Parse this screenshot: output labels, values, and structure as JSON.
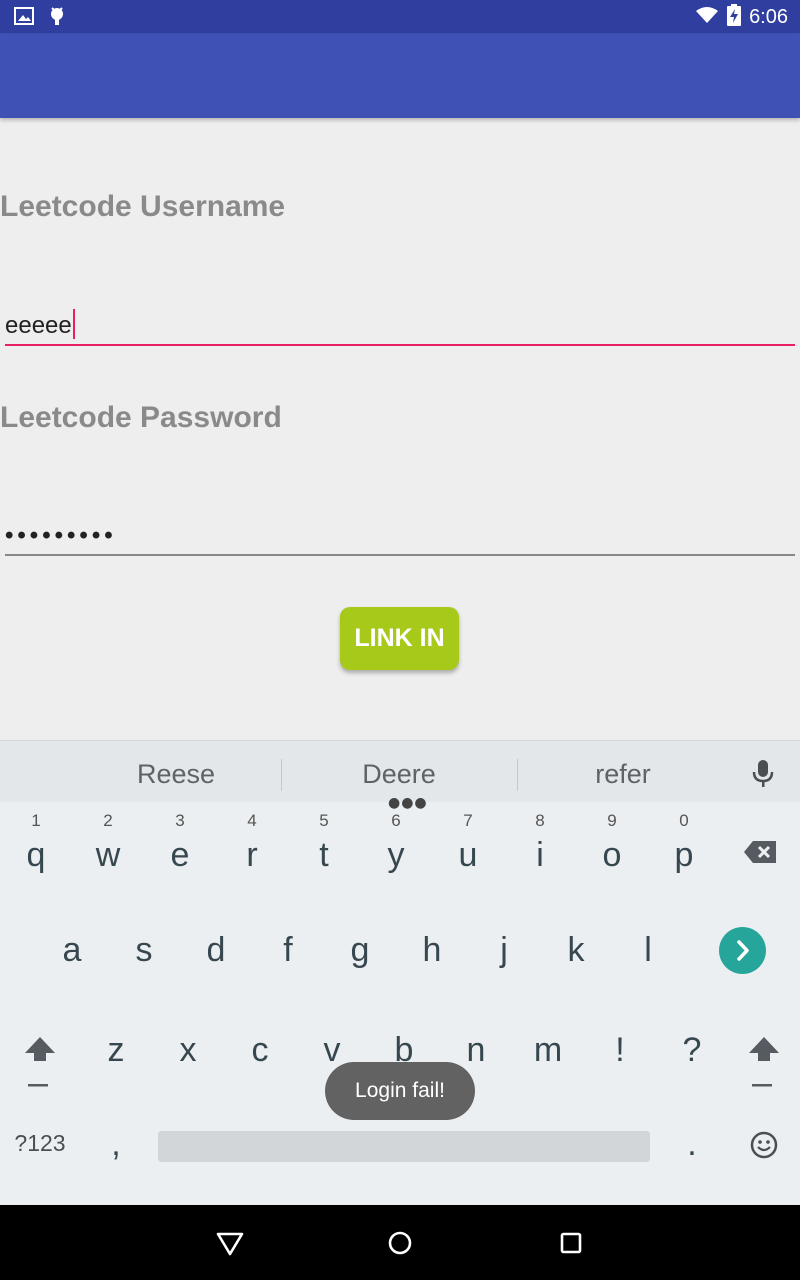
{
  "status_bar": {
    "time": "6:06",
    "left_icons": [
      "image-icon",
      "android-debug-icon"
    ],
    "right_icons": [
      "wifi-icon",
      "battery-charging-icon"
    ]
  },
  "app_bar": {
    "color": "#3f51b5"
  },
  "form": {
    "username_label": "Leetcode Username",
    "username_value": "eeeee",
    "password_label": "Leetcode Password",
    "password_value": "•••••••••",
    "login_button": "LINK IN"
  },
  "keyboard": {
    "suggestions": [
      "Reese",
      "Deere",
      "refer"
    ],
    "row1": [
      {
        "key": "q",
        "hint": "1"
      },
      {
        "key": "w",
        "hint": "2"
      },
      {
        "key": "e",
        "hint": "3"
      },
      {
        "key": "r",
        "hint": "4"
      },
      {
        "key": "t",
        "hint": "5"
      },
      {
        "key": "y",
        "hint": "6"
      },
      {
        "key": "u",
        "hint": "7"
      },
      {
        "key": "i",
        "hint": "8"
      },
      {
        "key": "o",
        "hint": "9"
      },
      {
        "key": "p",
        "hint": "0"
      }
    ],
    "row2": [
      "a",
      "s",
      "d",
      "f",
      "g",
      "h",
      "j",
      "k",
      "l"
    ],
    "row3": [
      "z",
      "x",
      "c",
      "v",
      "b",
      "n",
      "m",
      "!",
      "?"
    ],
    "symbols_key": "?123",
    "comma_key": ",",
    "period_key": ".",
    "enter_color": "#26a69a"
  },
  "toast": {
    "message": "Login fail!"
  },
  "accent_color": "#e91e63",
  "button_color": "#a6c91a"
}
